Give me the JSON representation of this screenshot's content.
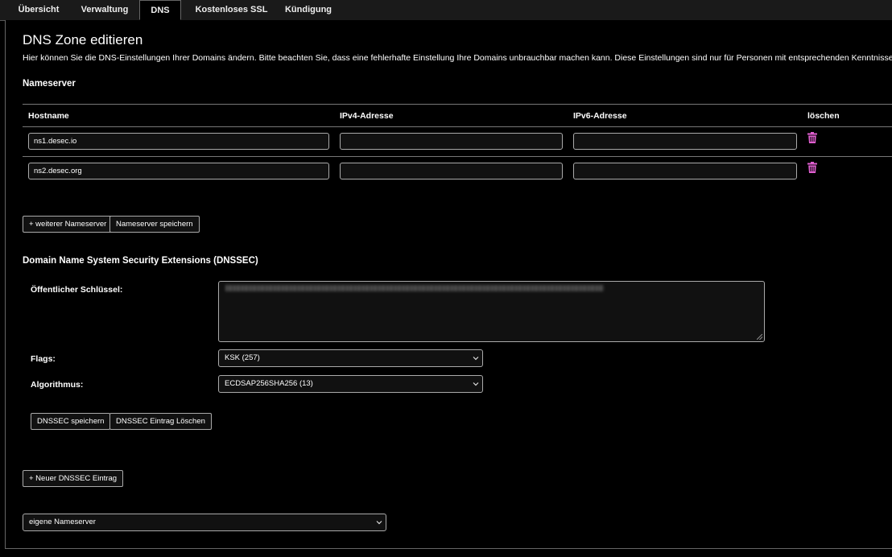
{
  "tabs": [
    {
      "label": "Übersicht"
    },
    {
      "label": "Verwaltung"
    },
    {
      "label": "DNS"
    },
    {
      "label": "Kostenloses SSL"
    },
    {
      "label": "Kündigung"
    }
  ],
  "page": {
    "title": "DNS Zone editieren",
    "description": "Hier können Sie die DNS-Einstellungen Ihrer Domains ändern. Bitte beachten Sie, dass eine fehlerhafte Einstellung Ihre Domains unbrauchbar machen kann. Diese Einstellungen sind nur für Personen mit entsprechenden Kenntnissen gedacht"
  },
  "nameserver": {
    "heading": "Nameserver",
    "columns": [
      "Hostname",
      "IPv4-Adresse",
      "IPv6-Adresse",
      "löschen"
    ],
    "rows": [
      {
        "hostname": "ns1.desec.io",
        "ipv4": "",
        "ipv6": ""
      },
      {
        "hostname": "ns2.desec.org",
        "ipv4": "",
        "ipv6": ""
      }
    ],
    "add_button": "+ weiterer Nameserver",
    "save_button": "Nameserver speichern"
  },
  "dnssec": {
    "heading": "Domain Name System Security Extensions (DNSSEC)",
    "public_key_label": "Öffentlicher Schlüssel:",
    "flags_label": "Flags:",
    "flags_value": "KSK (257)",
    "algorithm_label": "Algorithmus:",
    "algorithm_value": "ECDSAP256SHA256 (13)",
    "save_button": "DNSSEC speichern",
    "delete_button": "DNSSEC Eintrag Löschen",
    "new_button": "+ Neuer DNSSEC Eintrag"
  },
  "nameserver_mode": {
    "value": "eigene Nameserver"
  },
  "colors": {
    "trash_icon": "#e05fd0",
    "border": "#aaaaaa",
    "background": "#000000"
  }
}
